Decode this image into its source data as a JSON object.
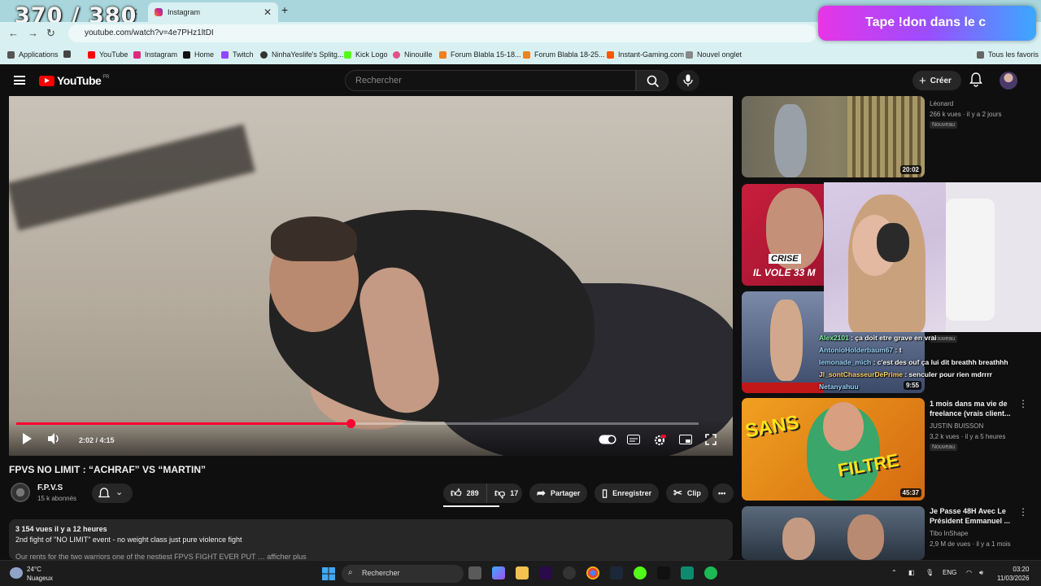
{
  "overlay": {
    "counter": "370 / 380",
    "banner": "Tape !don dans le c"
  },
  "browser": {
    "tabs": [
      {
        "label": "",
        "active": false
      },
      {
        "label": "Instagram",
        "active": true
      }
    ],
    "url": "youtube.com/watch?v=4e7PHz1ltDI",
    "bookmarks": [
      "Applications",
      "YouTube",
      "Instagram",
      "Home",
      "Twitch",
      "NinhaYeslife's Splitg...",
      "Kick Logo",
      "Ninouille",
      "Forum Blabla 15-18...",
      "Forum Blabla 18-25...",
      "Instant-Gaming.com",
      "Nouvel onglet",
      "Tous les favoris"
    ]
  },
  "youtube": {
    "logo_text": "YouTube",
    "logo_region": "FR",
    "search_placeholder": "Rechercher",
    "create_label": "Créer"
  },
  "player": {
    "time": "2:02 / 4:15",
    "progress_fraction": 0.49
  },
  "video": {
    "title": "FPVS NO LIMIT : “ACHRAF” VS “MARTIN”",
    "channel": "F.P.V.S",
    "subscribers": "15 k abonnés",
    "likes": "289",
    "dislikes": "17",
    "share_label": "Partager",
    "save_label": "Enregistrer",
    "clip_label": "Clip",
    "views_date": "3 154 vues  il y a 12 heures",
    "description": "2nd fight of \"NO LIMIT\" event - no weight class just pure violence fight",
    "description_cut": "Our rents for the two warriors one of the nestiest FPVS FIGHT EVER PUT … afficher plus"
  },
  "recommendations": [
    {
      "title": "",
      "channel": "Léonard",
      "meta": "266 k vues · il y a 2 jours",
      "badge": "Nouveau",
      "duration": "20:02"
    },
    {
      "title": "",
      "channel": "",
      "meta": "",
      "badge": "",
      "duration": "",
      "thumb_text": [
        "CRISE",
        "IL VOLE 33 M"
      ]
    },
    {
      "title": "",
      "channel": "",
      "meta": "",
      "badge": "Nouveau",
      "duration": "9:55"
    },
    {
      "title": "1 mois dans ma vie de freelance (vrais client...",
      "channel": "JUSTIN BUISSON",
      "meta": "3,2 k vues · il y a 5 heures",
      "badge": "Nouveau",
      "duration": "45:37",
      "thumb_text": [
        "SANS",
        "FILTRE"
      ]
    },
    {
      "title": "Je Passe 48H Avec Le Président Emmanuel ...",
      "channel": "Tibo InShape",
      "meta": "2,9 M de vues · il y a 1 mois",
      "badge": "",
      "duration": ""
    }
  ],
  "chat": [
    {
      "user": "Alex2101",
      "text": " : ça doit etre grave en vrai"
    },
    {
      "user": "AntonioHolderbaum67",
      "text": " : t"
    },
    {
      "user": "lemonade_mich",
      "text": " : c'est des ouf ça lui dit breathh breathhh"
    },
    {
      "user": "Jl_sontChasseurDePrime",
      "text": " : senculer pour rien mdrrrr"
    },
    {
      "user": "Netanyahuu",
      "text": " : ..."
    }
  ],
  "taskbar": {
    "temp": "24°C",
    "weather": "Nuageux",
    "search": "Rechercher",
    "lang": "ENG",
    "time": "03:20",
    "date": "11/03/2026"
  },
  "colors": {
    "accent_red": "#ff0033",
    "youtube_red": "#ff0000",
    "background": "#0f0f0f"
  }
}
